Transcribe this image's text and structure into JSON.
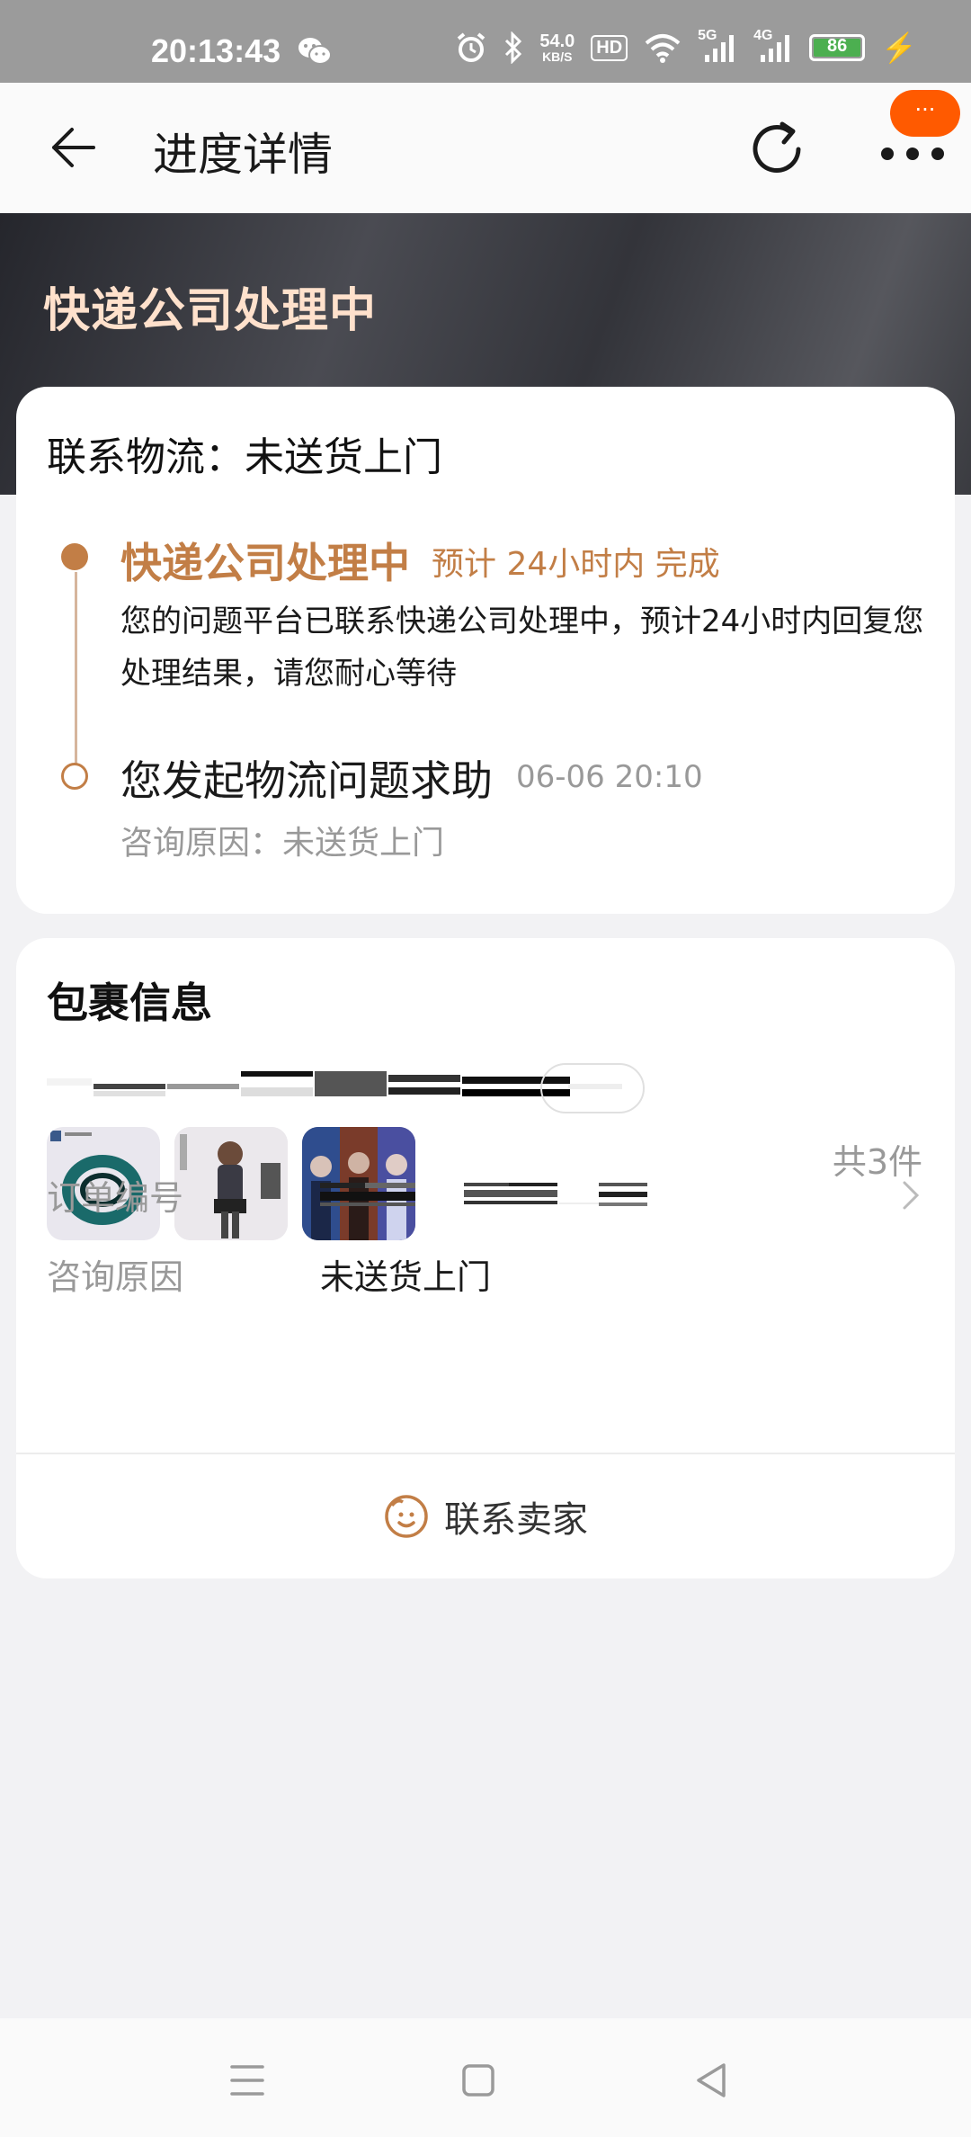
{
  "status_bar": {
    "time": "20:13:43",
    "speed_value": "54.0",
    "speed_unit": "KB/S",
    "hd_label": "HD",
    "net1": "5G",
    "net2": "4G",
    "battery": "86"
  },
  "header": {
    "title": "进度详情",
    "badge": "···"
  },
  "hero": {
    "status": "快递公司处理中"
  },
  "progress": {
    "heading": "联系物流：未送货上门",
    "steps": [
      {
        "title": "快递公司处理中",
        "eta": "预计 24小时内 完成",
        "desc": "您的问题平台已联系快递公司处理中，预计24小时内回复您处理结果，请您耐心等待"
      },
      {
        "title": "您发起物流问题求助",
        "time": "06-06 20:10",
        "reason": "咨询原因：未送货上门"
      }
    ]
  },
  "package": {
    "heading": "包裹信息",
    "count": "共3件",
    "order_label": "订单编号",
    "reason_label": "咨询原因",
    "reason_value": "未送货上门",
    "contact_label": "联系卖家"
  },
  "colors": {
    "accent": "#c27e46",
    "badge": "#ff5a00",
    "hero_text": "#ffe1cc"
  }
}
